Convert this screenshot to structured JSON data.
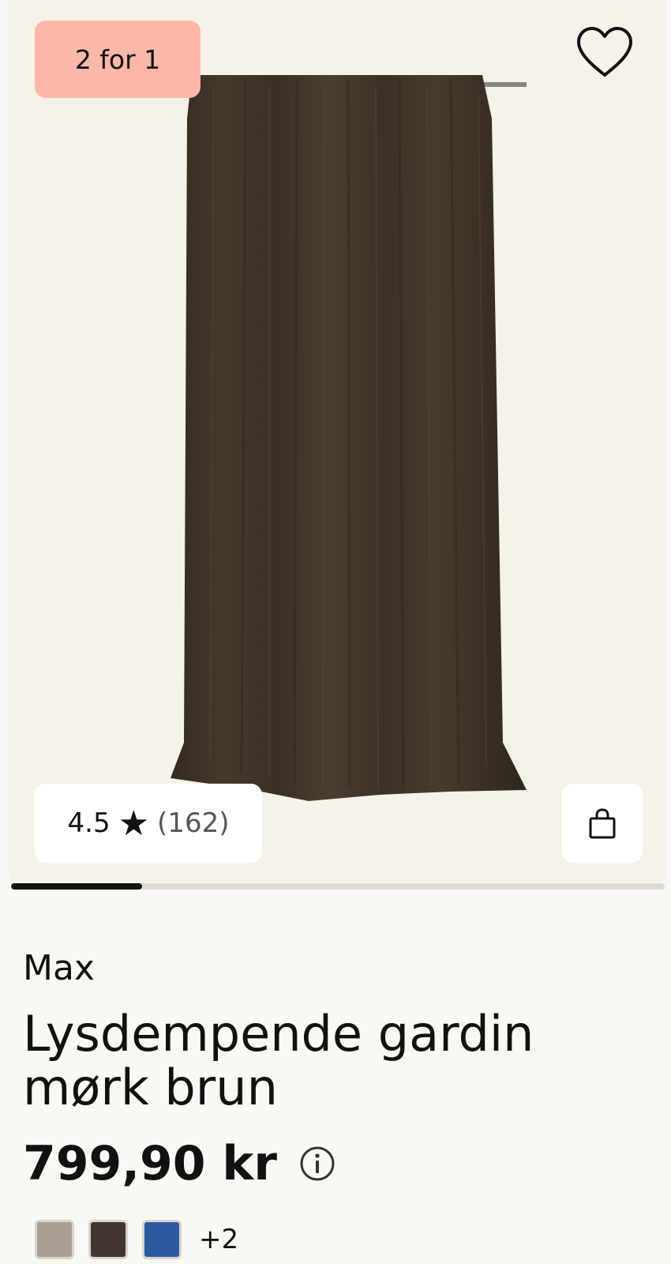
{
  "product": {
    "badge": "2 for 1",
    "brand": "Max",
    "title": "Lysdempende gardin mørk brun",
    "price": "799,90 kr"
  },
  "rating": {
    "score": "4.5",
    "star": "★",
    "count": "(162)"
  },
  "gallery": {
    "progress_fraction": 0.2
  },
  "swatches": {
    "colors": [
      "#aa9e92",
      "#433530",
      "#2b5aa0"
    ],
    "more": "+2"
  },
  "icons": {
    "favorite": "heart-icon",
    "cart": "shopping-bag-icon",
    "info": "info-icon"
  },
  "colors": {
    "badge": "#fbb7a8",
    "curtain": "#3f3427",
    "background": "#faf8f2"
  }
}
